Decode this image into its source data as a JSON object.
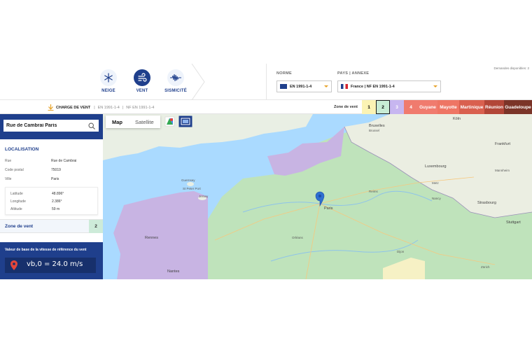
{
  "header": {
    "nav": [
      {
        "label": "NEIGE",
        "icon": "snowflake-icon"
      },
      {
        "label": "VENT",
        "icon": "wind-icon"
      },
      {
        "label": "SISMICITÉ",
        "icon": "seismic-wave-icon"
      }
    ],
    "norm_label": "NORME",
    "norm_value": "EN 1991-1-4",
    "country_label": "PAYS | ANNEXE",
    "country_value": "France | NF EN 1991-1-4",
    "requests_text": "Demandes disponibles: 2"
  },
  "subbar": {
    "title": "CHARGE DE VENT",
    "part1": "EN 1991-1-4",
    "part2": "NF EN 1991-1-4",
    "zone_label": "Zone de vent",
    "zones": [
      {
        "label": "1",
        "color": "#fbf3b4"
      },
      {
        "label": "2",
        "color": "#c8ecd4"
      },
      {
        "label": "3",
        "color": "#c7b6f0"
      },
      {
        "label": "4",
        "color": "#f07b6e"
      },
      {
        "label": "Guyane",
        "color": "#f07b6e"
      },
      {
        "label": "Mayotte",
        "color": "#ee7564"
      },
      {
        "label": "Martinique",
        "color": "#d9604f"
      },
      {
        "label": "Réunion",
        "color": "#b24638"
      },
      {
        "label": "Guadeloupe",
        "color": "#7b3428"
      }
    ],
    "selected_zone": "2"
  },
  "panel": {
    "search_value": "Rue de Cambrai Paris",
    "localisation_title": "LOCALISATION",
    "rue_label": "Rue",
    "rue_value": "Rue de Cambrai",
    "cp_label": "Code postal",
    "cp_value": "75019",
    "ville_label": "Ville",
    "ville_value": "Paris",
    "lat_label": "Latitude",
    "lat_value": "48.896°",
    "lon_label": "Longitude",
    "lon_value": "2.386°",
    "alt_label": "Altitude",
    "alt_value": "59 m",
    "zone_row_label": "Zone de vent",
    "zone_row_value": "2",
    "vb_title": "Valeur de base de la vitesse de référence du vent",
    "vb_formula": "vb,0 = 24.0 m/s"
  },
  "map": {
    "tab_map": "Map",
    "tab_satellite": "Satellite",
    "places": [
      "Guernsey",
      "St Peter Port",
      "Jersey",
      "Bruxelles",
      "Brussel",
      "Luxembourg",
      "Nancy",
      "Strasbourg",
      "Rennes",
      "Nantes",
      "Paris",
      "Reims",
      "Metz",
      "Frankfurt",
      "Mannheim",
      "Stuttgart",
      "Köln",
      "Zürich",
      "Dijon",
      "Orléans"
    ]
  },
  "colors": {
    "brand_blue": "#1f3f8c",
    "zone2_green": "#bfe3bb",
    "zone3_purple": "#c8b4e3",
    "accent_orange": "#e7a32a"
  }
}
